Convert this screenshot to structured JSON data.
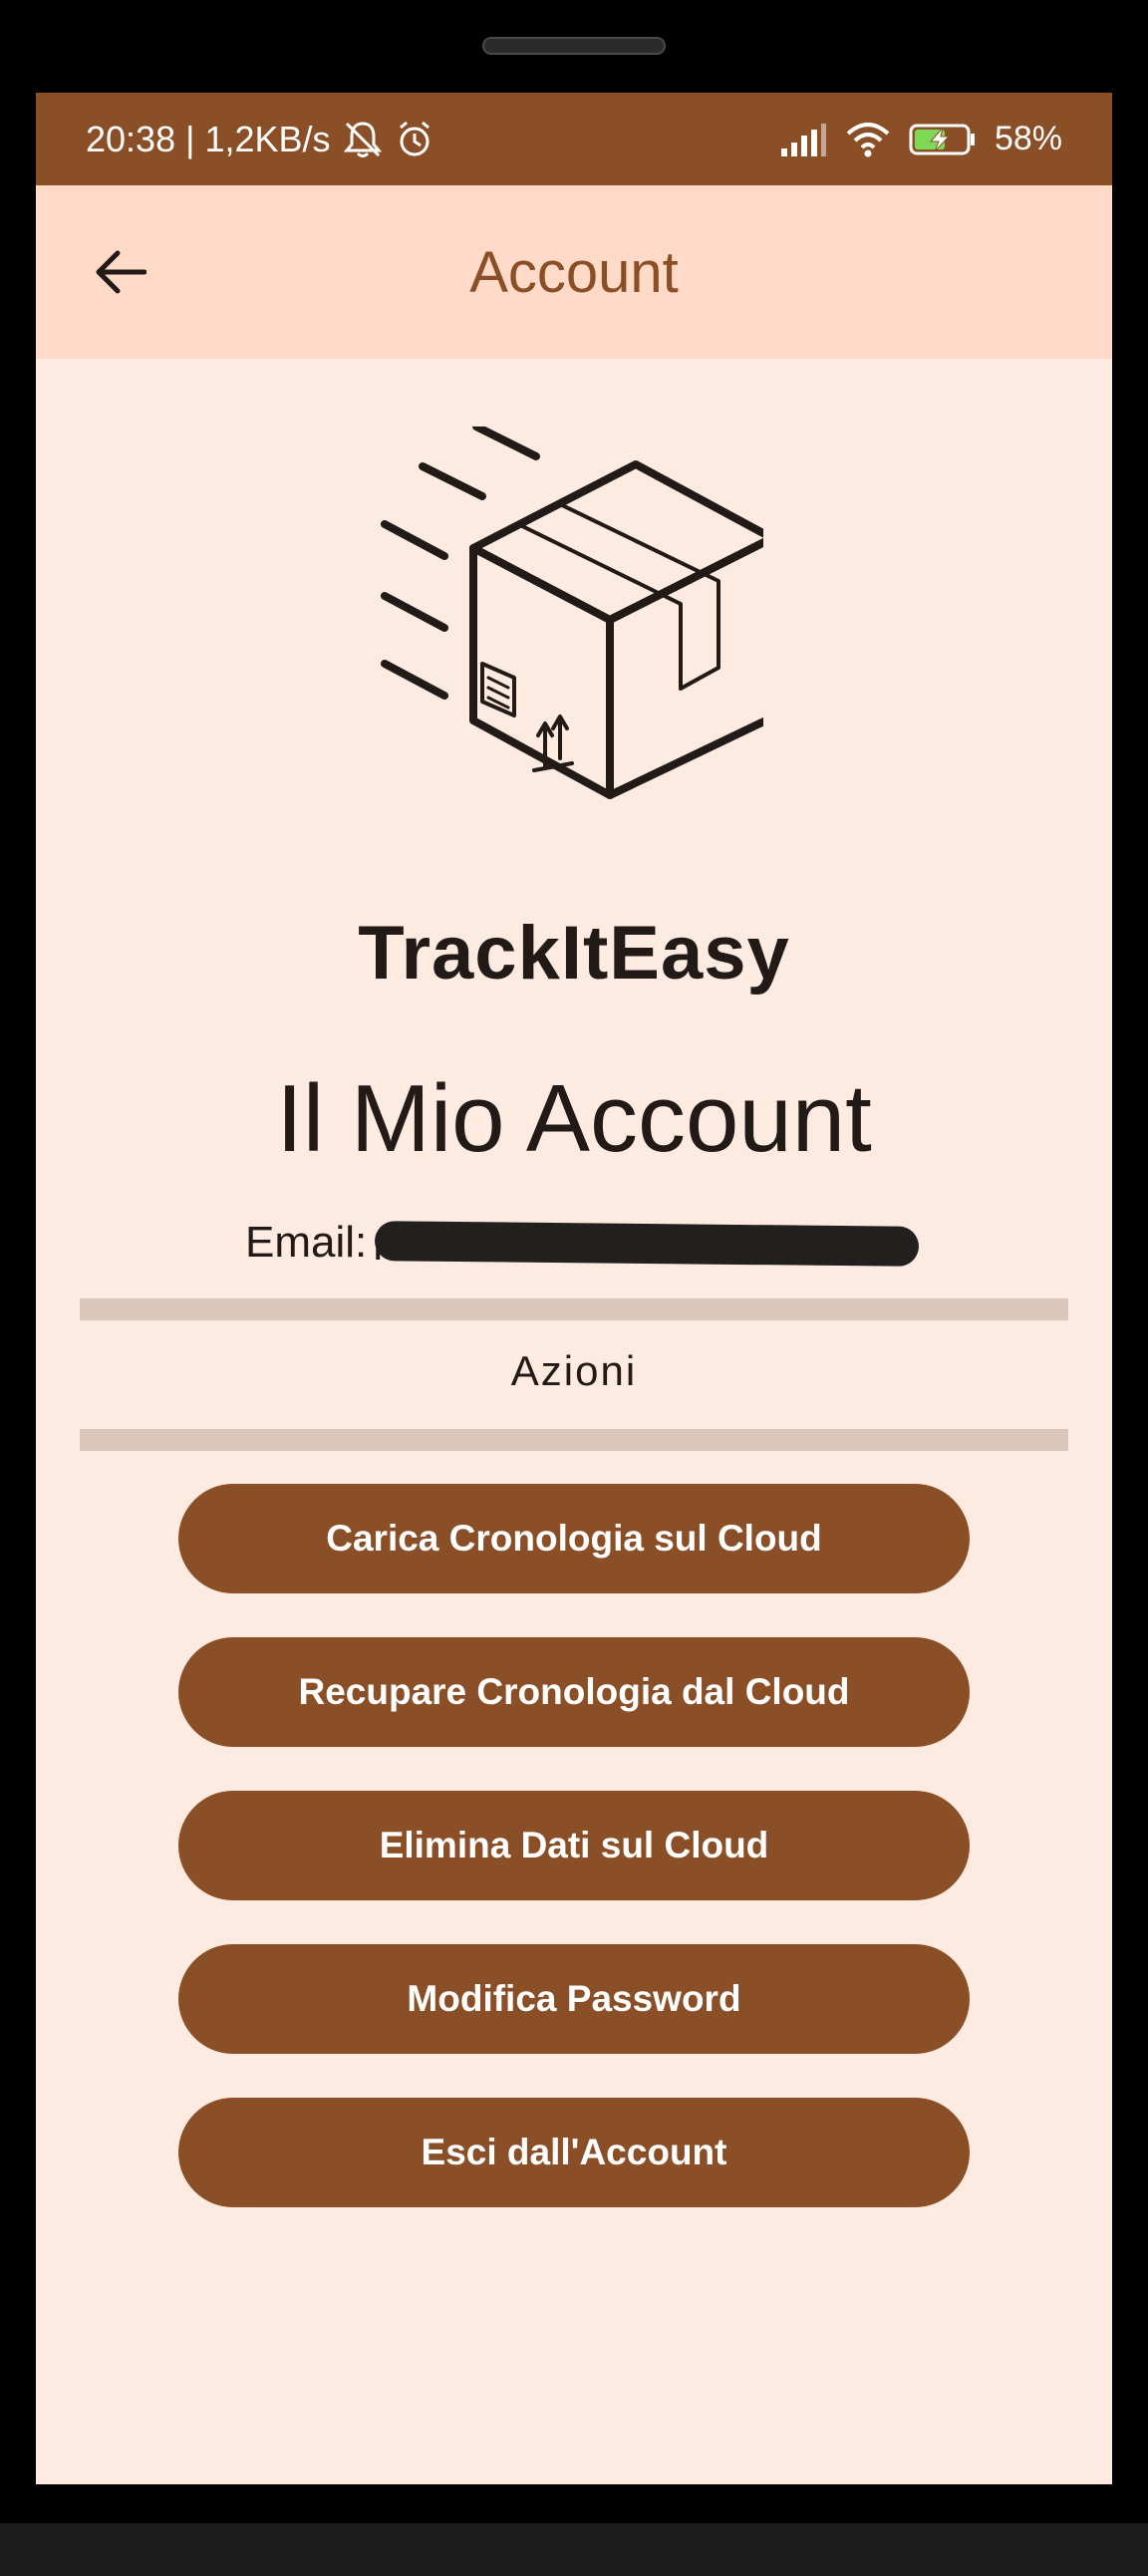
{
  "status_bar": {
    "time": "20:38",
    "separator": "|",
    "network_speed": "1,2KB/s",
    "battery": "58%",
    "icons": [
      "mute-icon",
      "alarm-icon",
      "signal-icon",
      "wifi-icon",
      "battery-charging-icon"
    ]
  },
  "app_bar": {
    "title": "Account",
    "back_icon": "arrow-left-icon"
  },
  "brand": {
    "name": "TrackItEasy",
    "logo_icon": "package-box-icon"
  },
  "account": {
    "title": "Il Mio Account",
    "email_label": "Email:",
    "email_value": "redacted"
  },
  "actions": {
    "section_label": "Azioni",
    "buttons": [
      "Carica Cronologia sul Cloud",
      "Recupare Cronologia dal Cloud",
      "Elimina Dati sul Cloud",
      "Modifica Password",
      "Esci dall'Account"
    ]
  },
  "colors": {
    "primary": "#8b4f27",
    "app_bar_bg": "#ffdac8",
    "screen_bg": "#fdebe1",
    "divider": "#dbc6ba",
    "text": "#221a16"
  }
}
